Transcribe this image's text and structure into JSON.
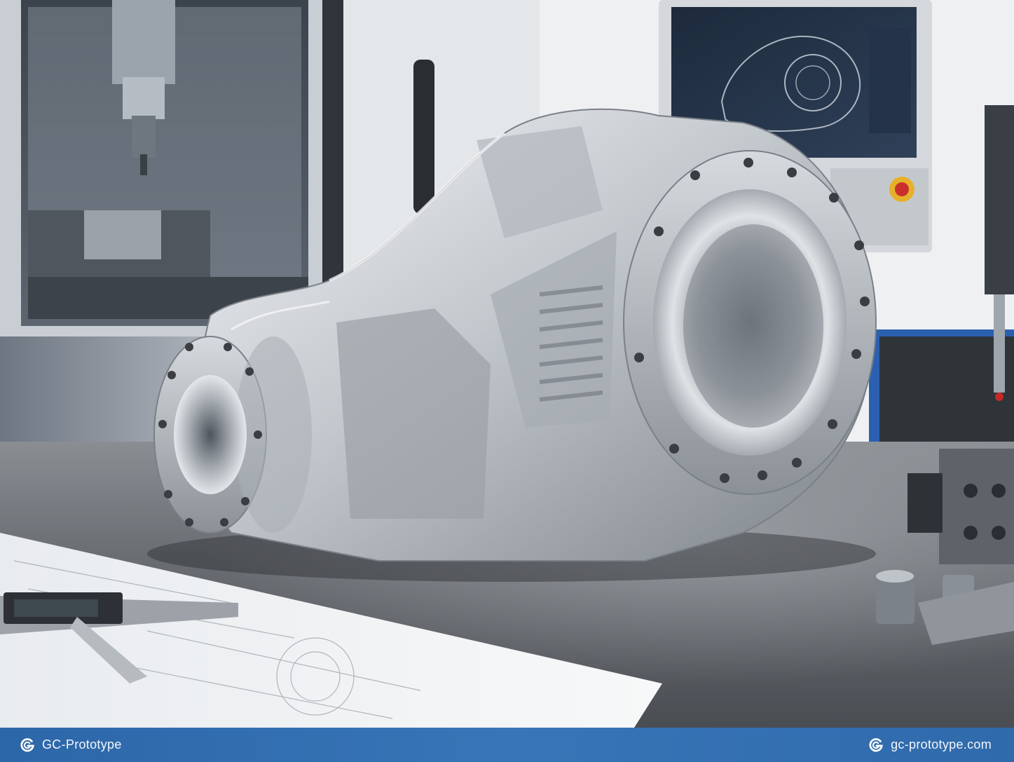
{
  "footer": {
    "brand_name": "GC-Prototype",
    "website": "gc-prototype.com",
    "logo_icon": "gc-logo-icon",
    "bar_color": "#3471b3"
  },
  "colors": {
    "aluminum_light": "#e6e9ec",
    "aluminum_mid": "#b7bcc2",
    "aluminum_dark": "#6d737a",
    "granite": "#5a5e63",
    "accent_blue": "#2b5fb0"
  }
}
